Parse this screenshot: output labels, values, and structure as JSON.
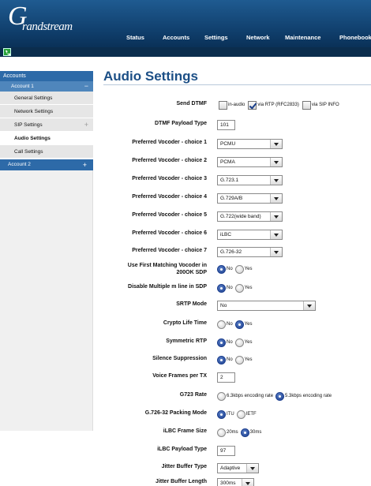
{
  "brand": {
    "logo_g": "G",
    "logo_rest": "randstream"
  },
  "nav": [
    "Status",
    "Accounts",
    "Settings",
    "Network",
    "Maintenance",
    "Phonebook"
  ],
  "sidebar": {
    "top": "Accounts",
    "account1": {
      "label": "Account 1",
      "toggle": "−"
    },
    "items": [
      {
        "label": "General Settings"
      },
      {
        "label": "Network Settings"
      },
      {
        "label": "SIP Settings",
        "toggle": "+"
      },
      {
        "label": "Audio Settings"
      },
      {
        "label": "Call Settings"
      }
    ],
    "account2": {
      "label": "Account 2",
      "toggle": "+"
    }
  },
  "page": {
    "title": "Audio Settings"
  },
  "form": {
    "send_dtmf": {
      "label": "Send DTMF",
      "opt1": "in-audio",
      "opt2": "via RTP (RFC2833)",
      "opt3": "via SIP INFO"
    },
    "dtmf_payload": {
      "label": "DTMF Payload Type",
      "value": "101"
    },
    "vocoders": [
      {
        "label": "Preferred Vocoder - choice 1",
        "value": "PCMU"
      },
      {
        "label": "Preferred Vocoder - choice 2",
        "value": "PCMA"
      },
      {
        "label": "Preferred Vocoder - choice 3",
        "value": "G.723.1"
      },
      {
        "label": "Preferred Vocoder - choice 4",
        "value": "G.729A/B"
      },
      {
        "label": "Preferred Vocoder - choice 5",
        "value": "G.722(wide band)"
      },
      {
        "label": "Preferred Vocoder - choice 6",
        "value": "iLBC"
      },
      {
        "label": "Preferred Vocoder - choice 7",
        "value": "G.726-32"
      }
    ],
    "first_matching": {
      "label1": "Use First Matching Vocoder in",
      "label2": "200OK SDP",
      "no": "No",
      "yes": "Yes"
    },
    "disable_m": {
      "label": "Disable Multiple m line in SDP",
      "no": "No",
      "yes": "Yes"
    },
    "srtp": {
      "label": "SRTP Mode",
      "value": "No"
    },
    "crypto": {
      "label": "Crypto Life Time",
      "no": "No",
      "yes": "Yes"
    },
    "symmetric": {
      "label": "Symmetric RTP",
      "no": "No",
      "yes": "Yes"
    },
    "silence": {
      "label": "Silence Suppression",
      "no": "No",
      "yes": "Yes"
    },
    "voice_frames": {
      "label": "Voice Frames per TX",
      "value": "2"
    },
    "g723": {
      "label": "G723 Rate",
      "opt1": "6.3kbps encoding rate",
      "opt2": "5.3kbps encoding rate"
    },
    "g726": {
      "label": "G.726-32 Packing Mode",
      "opt1": "ITU",
      "opt2": "IETF"
    },
    "ilbc_frame": {
      "label": "iLBC Frame Size",
      "opt1": "20ms",
      "opt2": "30ms"
    },
    "ilbc_payload": {
      "label": "iLBC Payload Type",
      "value": "97"
    },
    "jitter_type": {
      "label": "Jitter Buffer Type",
      "value": "Adaptive"
    },
    "jitter_len": {
      "label": "Jitter Buffer Length",
      "value": "300ms"
    }
  }
}
